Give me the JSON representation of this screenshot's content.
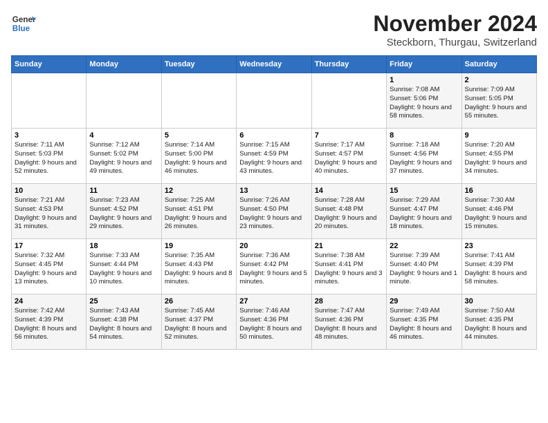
{
  "logo": {
    "line1": "General",
    "line2": "Blue"
  },
  "title": "November 2024",
  "subtitle": "Steckborn, Thurgau, Switzerland",
  "days_of_week": [
    "Sunday",
    "Monday",
    "Tuesday",
    "Wednesday",
    "Thursday",
    "Friday",
    "Saturday"
  ],
  "weeks": [
    [
      {
        "day": "",
        "info": ""
      },
      {
        "day": "",
        "info": ""
      },
      {
        "day": "",
        "info": ""
      },
      {
        "day": "",
        "info": ""
      },
      {
        "day": "",
        "info": ""
      },
      {
        "day": "1",
        "info": "Sunrise: 7:08 AM\nSunset: 5:06 PM\nDaylight: 9 hours and 58 minutes."
      },
      {
        "day": "2",
        "info": "Sunrise: 7:09 AM\nSunset: 5:05 PM\nDaylight: 9 hours and 55 minutes."
      }
    ],
    [
      {
        "day": "3",
        "info": "Sunrise: 7:11 AM\nSunset: 5:03 PM\nDaylight: 9 hours and 52 minutes."
      },
      {
        "day": "4",
        "info": "Sunrise: 7:12 AM\nSunset: 5:02 PM\nDaylight: 9 hours and 49 minutes."
      },
      {
        "day": "5",
        "info": "Sunrise: 7:14 AM\nSunset: 5:00 PM\nDaylight: 9 hours and 46 minutes."
      },
      {
        "day": "6",
        "info": "Sunrise: 7:15 AM\nSunset: 4:59 PM\nDaylight: 9 hours and 43 minutes."
      },
      {
        "day": "7",
        "info": "Sunrise: 7:17 AM\nSunset: 4:57 PM\nDaylight: 9 hours and 40 minutes."
      },
      {
        "day": "8",
        "info": "Sunrise: 7:18 AM\nSunset: 4:56 PM\nDaylight: 9 hours and 37 minutes."
      },
      {
        "day": "9",
        "info": "Sunrise: 7:20 AM\nSunset: 4:55 PM\nDaylight: 9 hours and 34 minutes."
      }
    ],
    [
      {
        "day": "10",
        "info": "Sunrise: 7:21 AM\nSunset: 4:53 PM\nDaylight: 9 hours and 31 minutes."
      },
      {
        "day": "11",
        "info": "Sunrise: 7:23 AM\nSunset: 4:52 PM\nDaylight: 9 hours and 29 minutes."
      },
      {
        "day": "12",
        "info": "Sunrise: 7:25 AM\nSunset: 4:51 PM\nDaylight: 9 hours and 26 minutes."
      },
      {
        "day": "13",
        "info": "Sunrise: 7:26 AM\nSunset: 4:50 PM\nDaylight: 9 hours and 23 minutes."
      },
      {
        "day": "14",
        "info": "Sunrise: 7:28 AM\nSunset: 4:48 PM\nDaylight: 9 hours and 20 minutes."
      },
      {
        "day": "15",
        "info": "Sunrise: 7:29 AM\nSunset: 4:47 PM\nDaylight: 9 hours and 18 minutes."
      },
      {
        "day": "16",
        "info": "Sunrise: 7:30 AM\nSunset: 4:46 PM\nDaylight: 9 hours and 15 minutes."
      }
    ],
    [
      {
        "day": "17",
        "info": "Sunrise: 7:32 AM\nSunset: 4:45 PM\nDaylight: 9 hours and 13 minutes."
      },
      {
        "day": "18",
        "info": "Sunrise: 7:33 AM\nSunset: 4:44 PM\nDaylight: 9 hours and 10 minutes."
      },
      {
        "day": "19",
        "info": "Sunrise: 7:35 AM\nSunset: 4:43 PM\nDaylight: 9 hours and 8 minutes."
      },
      {
        "day": "20",
        "info": "Sunrise: 7:36 AM\nSunset: 4:42 PM\nDaylight: 9 hours and 5 minutes."
      },
      {
        "day": "21",
        "info": "Sunrise: 7:38 AM\nSunset: 4:41 PM\nDaylight: 9 hours and 3 minutes."
      },
      {
        "day": "22",
        "info": "Sunrise: 7:39 AM\nSunset: 4:40 PM\nDaylight: 9 hours and 1 minute."
      },
      {
        "day": "23",
        "info": "Sunrise: 7:41 AM\nSunset: 4:39 PM\nDaylight: 8 hours and 58 minutes."
      }
    ],
    [
      {
        "day": "24",
        "info": "Sunrise: 7:42 AM\nSunset: 4:39 PM\nDaylight: 8 hours and 56 minutes."
      },
      {
        "day": "25",
        "info": "Sunrise: 7:43 AM\nSunset: 4:38 PM\nDaylight: 8 hours and 54 minutes."
      },
      {
        "day": "26",
        "info": "Sunrise: 7:45 AM\nSunset: 4:37 PM\nDaylight: 8 hours and 52 minutes."
      },
      {
        "day": "27",
        "info": "Sunrise: 7:46 AM\nSunset: 4:36 PM\nDaylight: 8 hours and 50 minutes."
      },
      {
        "day": "28",
        "info": "Sunrise: 7:47 AM\nSunset: 4:36 PM\nDaylight: 8 hours and 48 minutes."
      },
      {
        "day": "29",
        "info": "Sunrise: 7:49 AM\nSunset: 4:35 PM\nDaylight: 8 hours and 46 minutes."
      },
      {
        "day": "30",
        "info": "Sunrise: 7:50 AM\nSunset: 4:35 PM\nDaylight: 8 hours and 44 minutes."
      }
    ]
  ]
}
